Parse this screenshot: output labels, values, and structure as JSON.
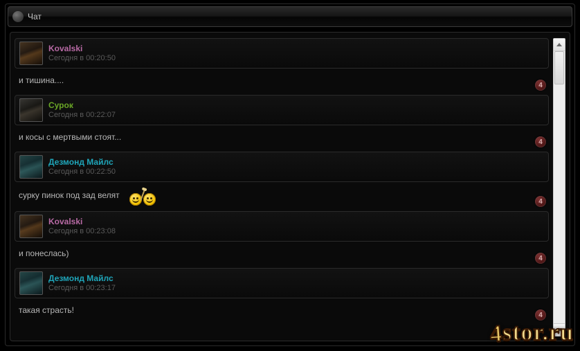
{
  "title": "Чат",
  "badge": "4",
  "watermark": {
    "four": "4",
    "rest": "stor.ru"
  },
  "messages": [
    {
      "author_key": "kov",
      "name": "Kovalski",
      "time": "Сегодня в 00:20:50",
      "text": "и тишина....",
      "emoji": false
    },
    {
      "author_key": "sur",
      "name": "Сурок",
      "time": "Сегодня в 00:22:07",
      "text": "и косы с мертвыми стоят...",
      "emoji": false
    },
    {
      "author_key": "dez",
      "name": "Дезмонд Майлс",
      "time": "Сегодня в 00:22:50",
      "text": "сурку пинок под зад велят",
      "emoji": true
    },
    {
      "author_key": "kov",
      "name": "Kovalski",
      "time": "Сегодня в 00:23:08",
      "text": "и понеслась)",
      "emoji": false
    },
    {
      "author_key": "dez",
      "name": "Дезмонд Майлс",
      "time": "Сегодня в 00:23:17",
      "text": "такая страсть!",
      "emoji": false
    }
  ]
}
